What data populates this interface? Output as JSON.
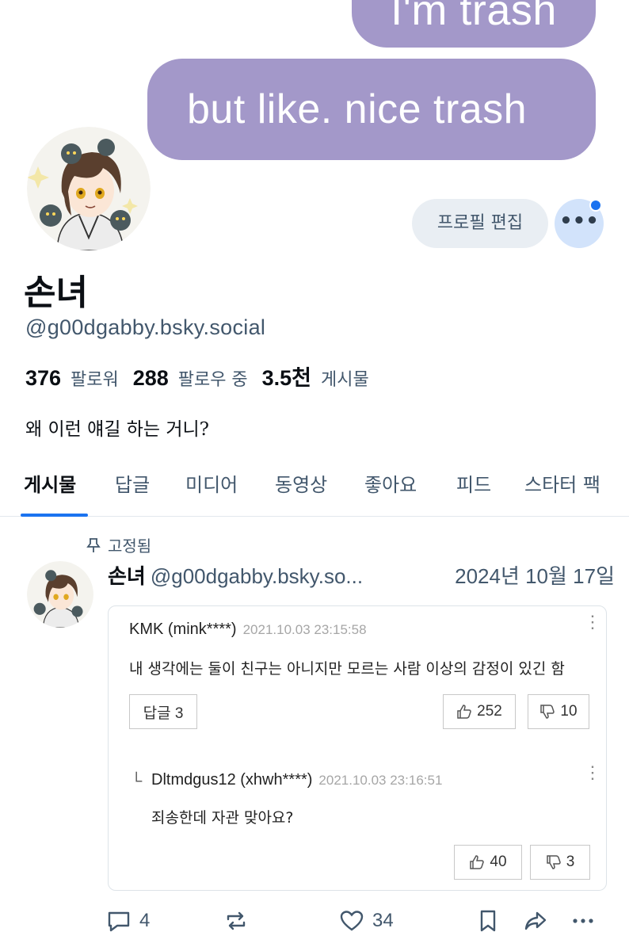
{
  "banner": {
    "line1": "I'm trash",
    "line2": "but like. nice trash"
  },
  "profile": {
    "edit_label": "프로필 편집",
    "more_label": "•••",
    "display_name": "손녀",
    "handle": "@g00dgabby.bsky.social",
    "followers_count": "376",
    "followers_label": "팔로워",
    "following_count": "288",
    "following_label": "팔로우 중",
    "posts_count": "3.5천",
    "posts_label": "게시물",
    "bio": "왜 이런 얘길 하는 거니?"
  },
  "tabs": [
    "게시물",
    "답글",
    "미디어",
    "동영상",
    "좋아요",
    "피드",
    "스타터 팩"
  ],
  "post": {
    "pinned_label": "고정됨",
    "author_name": "손녀",
    "author_handle": "@g00dgabby.bsky.so...",
    "date": "2024년 10월 17일",
    "embed": {
      "comment_user": "KMK (mink****)",
      "comment_date": "2021.10.03 23:15:58",
      "comment_text": "내 생각에는 둘이 친구는 아니지만 모르는 사람 이상의 감정이 있긴 함",
      "reply_button": "답글 3",
      "comment_likes": "252",
      "comment_dislikes": "10",
      "reply_user": "Dltmdgus12 (xhwh****)",
      "reply_date": "2021.10.03 23:16:51",
      "reply_text": "죄송한데 자관 맞아요?",
      "reply_likes": "40",
      "reply_dislikes": "3"
    },
    "replies_count": "4",
    "likes_count": "34"
  },
  "colors": {
    "accent": "#1b73f0",
    "bubble": "#a398c9",
    "muted_text": "#42576c"
  }
}
